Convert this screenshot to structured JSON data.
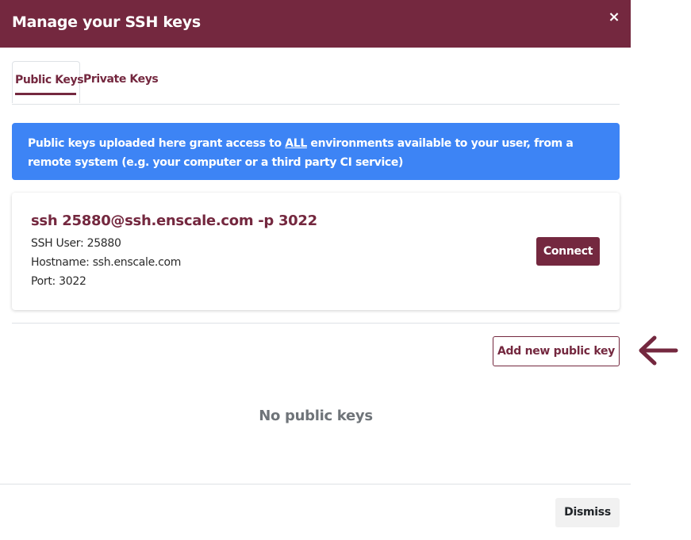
{
  "modal": {
    "title": "Manage your SSH keys",
    "close_glyph": "×",
    "tabs": [
      {
        "label": "Public Keys",
        "active": true
      },
      {
        "label": "Private Keys",
        "active": false
      }
    ]
  },
  "alert": {
    "text_before": "Public keys uploaded here grant access to ",
    "emphasis": "ALL",
    "text_after": " environments available to your user, from a remote system (e.g. your computer or a third party CI service)"
  },
  "ssh_card": {
    "command": "ssh 25880@ssh.enscale.com -p 3022",
    "user_line": "SSH User: 25880",
    "hostname_line": "Hostname: ssh.enscale.com",
    "port_line": "Port: 3022",
    "connect_label": "Connect"
  },
  "actions": {
    "add_key_label": "Add new public key"
  },
  "empty_state": "No public keys",
  "footer": {
    "dismiss_label": "Dismiss"
  },
  "colors": {
    "brand": "#74283f",
    "info": "#3d84f5",
    "muted": "#6f7479"
  },
  "icons": {
    "close": "close-icon",
    "annotation": "arrow-left-icon"
  }
}
